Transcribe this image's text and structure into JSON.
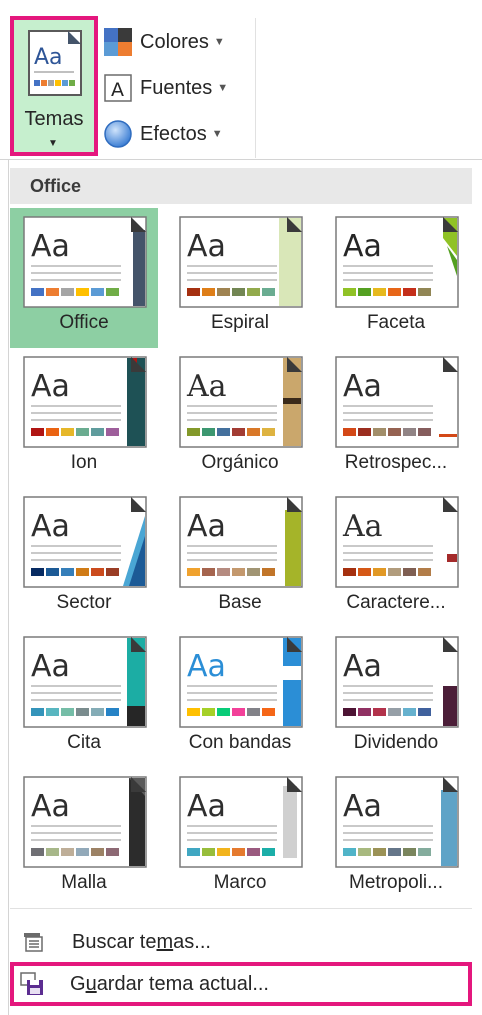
{
  "ribbon": {
    "themes_button": {
      "label": "Temas",
      "icon": "themes-aa-icon"
    },
    "colors_button": {
      "label": "Colores",
      "icon": "colors-icon"
    },
    "fonts_button": {
      "label": "Fuentes",
      "icon": "fonts-a-icon"
    },
    "effects_button": {
      "label": "Efectos",
      "icon": "effects-circle-icon"
    }
  },
  "gallery": {
    "section_title": "Office",
    "themes": [
      {
        "name": "Office",
        "selected": true,
        "accent": "#44546a",
        "style": "office",
        "swatches": [
          "#4472c4",
          "#ed7d31",
          "#a5a5a5",
          "#ffc000",
          "#5b9bd5",
          "#70ad47"
        ]
      },
      {
        "name": "Espiral",
        "selected": false,
        "accent": "#d9e7b8",
        "style": "espiral",
        "swatches": [
          "#a53010",
          "#de7e18",
          "#9f8351",
          "#728653",
          "#92aa4c",
          "#6aac91"
        ]
      },
      {
        "name": "Faceta",
        "selected": false,
        "accent": "#90c226",
        "style": "faceta",
        "swatches": [
          "#90c226",
          "#54a021",
          "#e6b91e",
          "#e76618",
          "#c42f1a",
          "#918655"
        ]
      },
      {
        "name": "Ion",
        "selected": false,
        "accent": "#1e5155",
        "style": "ion",
        "swatches": [
          "#b01513",
          "#ea6312",
          "#e6b729",
          "#6aac90",
          "#5f9c9d",
          "#9e5e9b"
        ]
      },
      {
        "name": "Orgánico",
        "selected": false,
        "accent": "#caa76c",
        "style": "organico",
        "swatches": [
          "#83992a",
          "#3c9770",
          "#44709d",
          "#a23c33",
          "#d97828",
          "#deb340"
        ]
      },
      {
        "name": "Retrospec...",
        "selected": false,
        "accent": "#d34817",
        "style": "retro",
        "swatches": [
          "#d34817",
          "#9b2d1f",
          "#a28e6a",
          "#956251",
          "#918485",
          "#855d5d"
        ]
      },
      {
        "name": "Sector",
        "selected": false,
        "accent": "#4aa6d4",
        "style": "sector",
        "swatches": [
          "#072b62",
          "#1c5a96",
          "#357eb9",
          "#d07b16",
          "#cb4b1d",
          "#9a3d25"
        ]
      },
      {
        "name": "Base",
        "selected": false,
        "accent": "#a5b429",
        "style": "base",
        "swatches": [
          "#f0a22e",
          "#a5644e",
          "#b58b80",
          "#c3986d",
          "#a19574",
          "#c17529"
        ]
      },
      {
        "name": "Caractere...",
        "selected": false,
        "accent": "#a42a2a",
        "style": "caracter",
        "swatches": [
          "#a5300f",
          "#d55816",
          "#e19825",
          "#b19c7d",
          "#7f5f52",
          "#b27d49"
        ]
      },
      {
        "name": "Cita",
        "selected": false,
        "accent": "#1cada4",
        "style": "cita",
        "swatches": [
          "#3494ba",
          "#58b6c0",
          "#75bda7",
          "#7a8c8e",
          "#84acb6",
          "#2683c6"
        ]
      },
      {
        "name": "Con bandas",
        "selected": false,
        "accent": "#2b8ed6",
        "style": "bandas",
        "swatches": [
          "#ffc000",
          "#a5d028",
          "#08cc78",
          "#f24099",
          "#828288",
          "#f56617"
        ]
      },
      {
        "name": "Dividendo",
        "selected": false,
        "accent": "#4b1e38",
        "style": "dividendo",
        "swatches": [
          "#4d1434",
          "#903163",
          "#b2324b",
          "#969fa7",
          "#66b1ce",
          "#40619d"
        ]
      },
      {
        "name": "Malla",
        "selected": false,
        "accent": "#2c2c2c",
        "style": "malla",
        "swatches": [
          "#6f6f74",
          "#a7b789",
          "#beae98",
          "#92a9b9",
          "#9c8265",
          "#8d6974"
        ]
      },
      {
        "name": "Marco",
        "selected": false,
        "accent": "#d0d0d0",
        "style": "marco",
        "swatches": [
          "#40a7c2",
          "#97bd3b",
          "#f2b41d",
          "#e57a2e",
          "#9a5a7f",
          "#1baea8"
        ]
      },
      {
        "name": "Metropoli...",
        "selected": false,
        "accent": "#5fa3c7",
        "style": "metropolitan",
        "swatches": [
          "#50b4c8",
          "#a8b97f",
          "#9b9256",
          "#657689",
          "#7a855d",
          "#84ac9d"
        ]
      }
    ]
  },
  "menu": {
    "browse_themes": {
      "pre": "Buscar te",
      "ul": "m",
      "post": "as...",
      "icon": "browse-folder-icon"
    },
    "save_theme": {
      "pre": "G",
      "ul": "u",
      "post": "ardar tema actual...",
      "icon": "save-disk-icon"
    }
  },
  "colors": {
    "highlight_border": "#e4177d",
    "selected_fill": "#8dcfa3",
    "button_fill": "#c6efce"
  }
}
